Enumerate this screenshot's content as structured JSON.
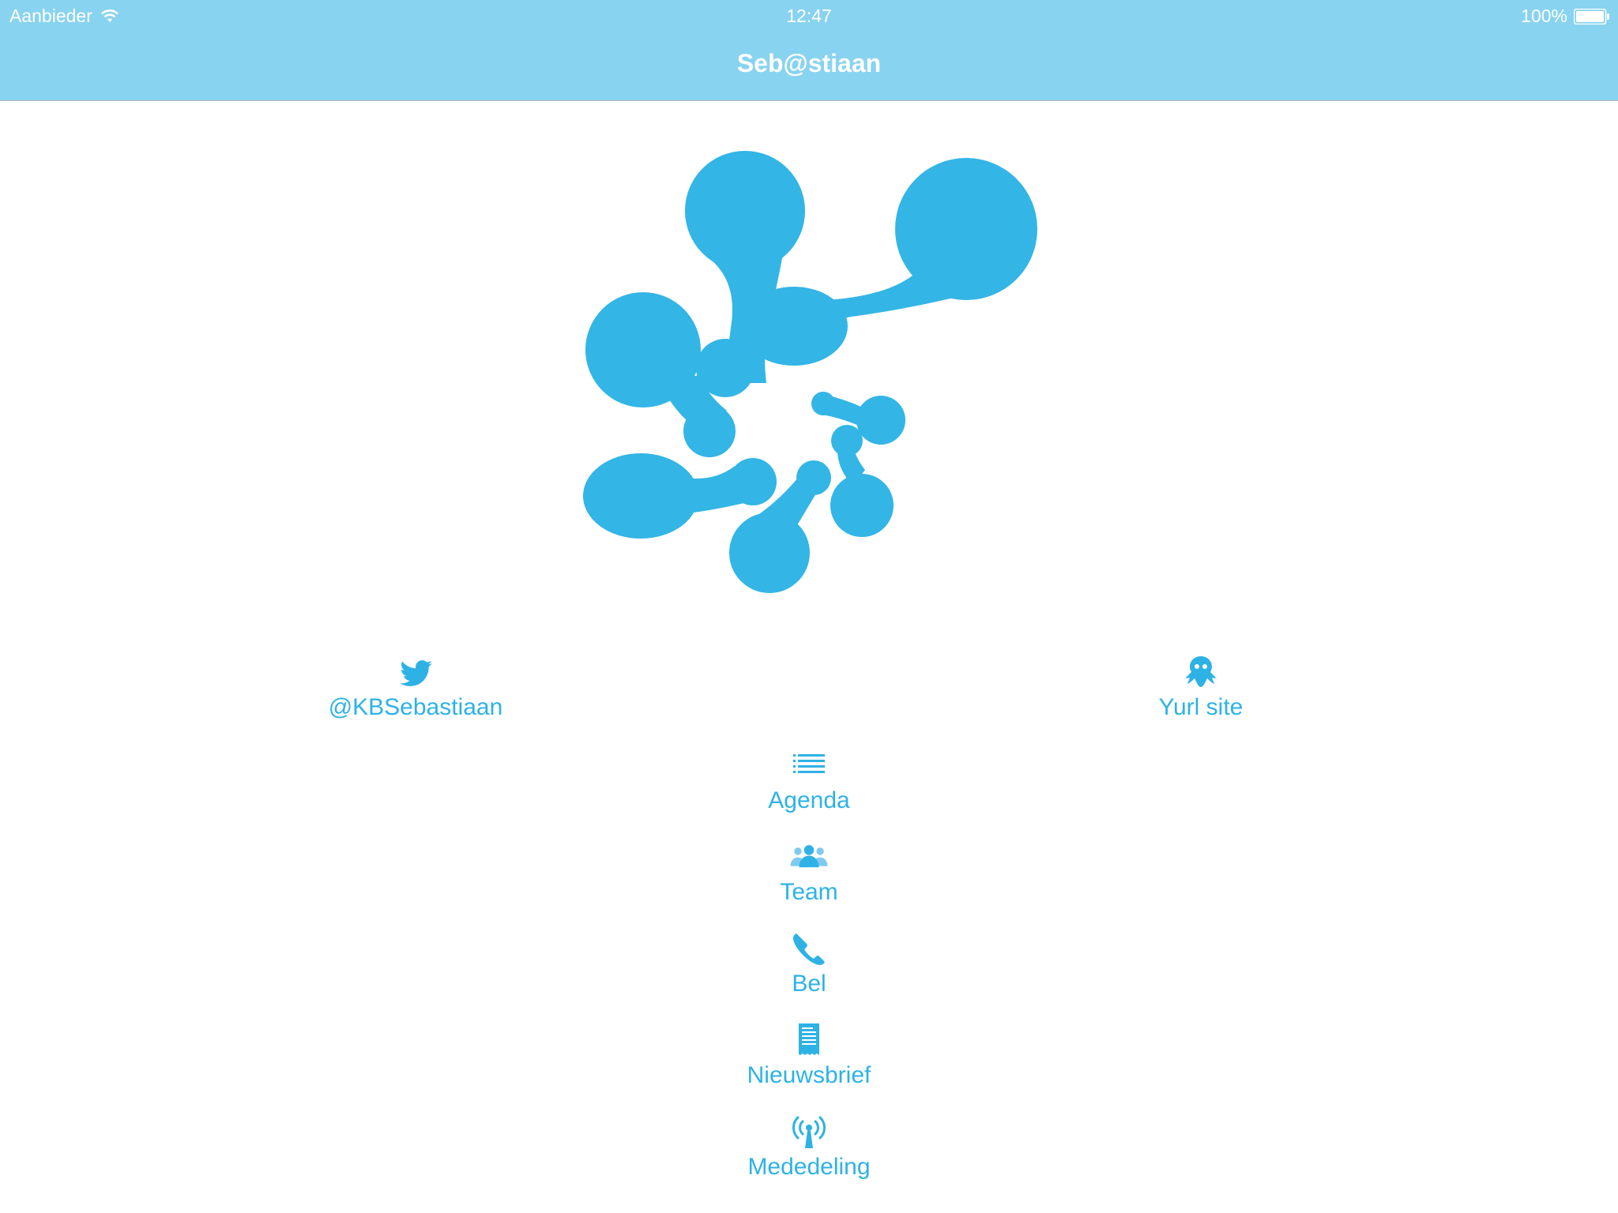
{
  "status": {
    "carrier": "Aanbieder",
    "time": "12:47",
    "battery": "100%"
  },
  "nav": {
    "title": "Seb@stiaan"
  },
  "accent_color": "#2eb2e6",
  "bar_color": "#88d3f0",
  "menu": {
    "twitter": {
      "label": "@KBSebastiaan",
      "icon": "twitter-bird-icon"
    },
    "yurl": {
      "label": "Yurl site",
      "icon": "yurl-mascot-icon"
    },
    "agenda": {
      "label": "Agenda",
      "icon": "list-icon"
    },
    "team": {
      "label": "Team",
      "icon": "team-icon"
    },
    "bel": {
      "label": "Bel",
      "icon": "phone-icon"
    },
    "nieuwsbrief": {
      "label": "Nieuwsbrief",
      "icon": "newsletter-icon"
    },
    "mededeling": {
      "label": "Mededeling",
      "icon": "broadcast-icon"
    }
  }
}
